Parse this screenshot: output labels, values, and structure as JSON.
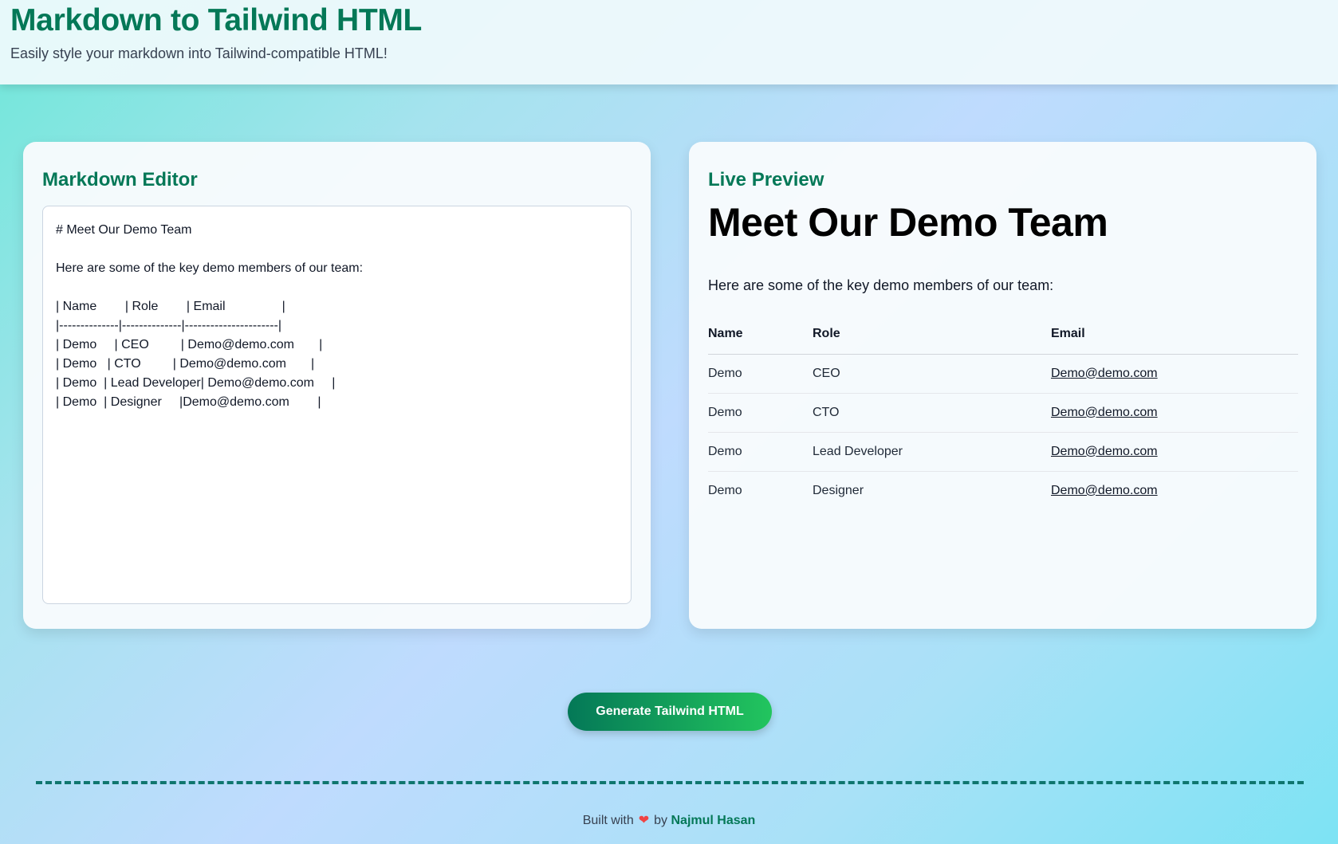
{
  "header": {
    "title": "Markdown to Tailwind HTML",
    "subtitle": "Easily style your markdown into Tailwind-compatible HTML!"
  },
  "editor": {
    "heading": "Markdown Editor",
    "content": "# Meet Our Demo Team\n\nHere are some of the key demo members of our team:\n\n| Name        | Role        | Email                |\n|--------------|--------------|----------------------|\n| Demo     | CEO         | Demo@demo.com       |\n| Demo   | CTO         | Demo@demo.com       |\n| Demo  | Lead Developer| Demo@demo.com     |\n| Demo  | Designer     |Demo@demo.com        |"
  },
  "preview": {
    "heading": "Live Preview",
    "title": "Meet Our Demo Team",
    "intro": "Here are some of the key demo members of our team:",
    "columns": [
      "Name",
      "Role",
      "Email"
    ],
    "rows": [
      [
        "Demo",
        "CEO",
        "Demo@demo.com"
      ],
      [
        "Demo",
        "CTO",
        "Demo@demo.com"
      ],
      [
        "Demo",
        "Lead Developer",
        "Demo@demo.com"
      ],
      [
        "Demo",
        "Designer",
        "Demo@demo.com"
      ]
    ]
  },
  "actions": {
    "generate_label": "Generate Tailwind HTML"
  },
  "footer": {
    "prefix": "Built with",
    "heart_icon": "❤",
    "by": "by",
    "author": "Najmul Hasan"
  },
  "colors": {
    "accent": "#047857",
    "button_gradient_end": "#22c55e",
    "heart": "#ef4444"
  }
}
